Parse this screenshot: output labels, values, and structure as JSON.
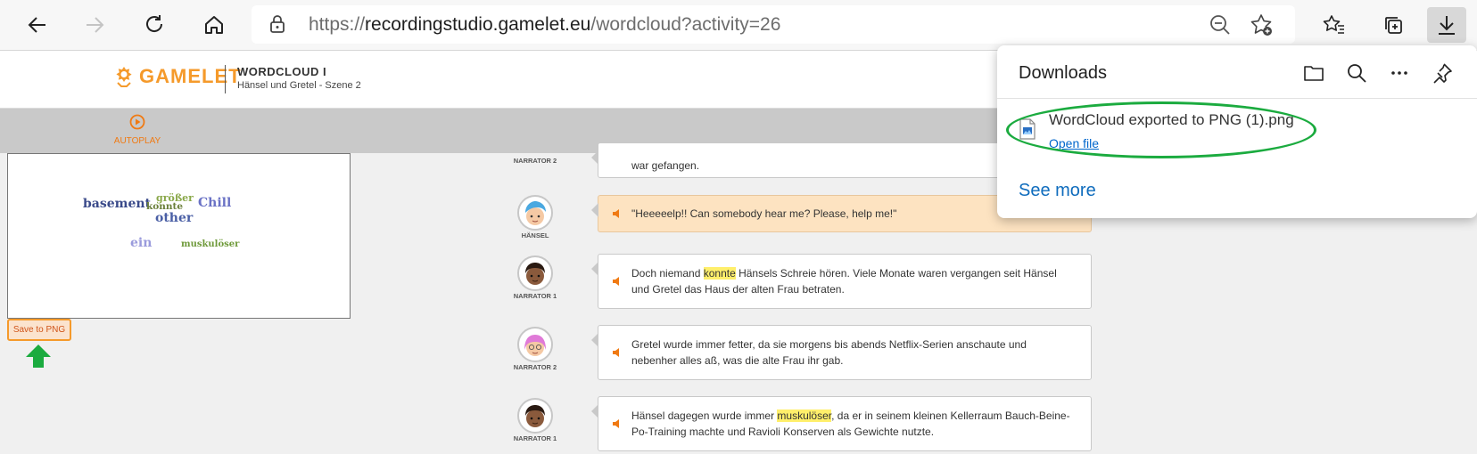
{
  "browser": {
    "url_scheme": "https://",
    "url_host": "recordingstudio.gamelet.eu",
    "url_path": "/wordcloud?activity=26"
  },
  "header": {
    "logo_text": "GAMELET",
    "title": "WORDCLOUD I",
    "subtitle": "Hänsel und Gretel - Szene 2"
  },
  "toolbar": {
    "autoplay_label": "AUTOPLAY"
  },
  "wordcloud": {
    "words": [
      {
        "text": "basement",
        "color": "#3a4a8a"
      },
      {
        "text": "größer",
        "color": "#8aa84a"
      },
      {
        "text": "konnte",
        "color": "#6a7f3a"
      },
      {
        "text": "other",
        "color": "#4a5fa5"
      },
      {
        "text": "Chill",
        "color": "#6a72c5"
      },
      {
        "text": "ein",
        "color": "#9a9bdc"
      },
      {
        "text": "muskulöser",
        "color": "#6f9a3b"
      }
    ],
    "save_label": "Save to PNG"
  },
  "dialogue": [
    {
      "speaker": "NARRATOR 2",
      "text": "war gefangen."
    },
    {
      "speaker": "HÄNSEL",
      "text": "\"Heeeeelp!! Can somebody hear me? Please, help me!\""
    },
    {
      "speaker": "NARRATOR 1",
      "before": "Doch niemand ",
      "highlight": "konnte",
      "after": " Hänsels Schreie hören. Viele Monate waren vergangen seit Hänsel und Gretel das Haus der alten Frau betraten."
    },
    {
      "speaker": "NARRATOR 2",
      "text": "Gretel wurde immer fetter, da sie morgens bis abends Netflix-Serien anschaute und nebenher alles aß, was die alte Frau ihr gab."
    },
    {
      "speaker": "NARRATOR 1",
      "before": "Hänsel dagegen wurde immer ",
      "highlight": "muskulöser",
      "after": ", da er in seinem kleinen Kellerraum Bauch-Beine-Po-Training machte und Ravioli Konserven als Gewichte nutzte."
    }
  ],
  "downloads": {
    "title": "Downloads",
    "file_name": "WordCloud exported to PNG (1).png",
    "open_file": "Open file",
    "see_more": "See more"
  },
  "colors": {
    "accent_orange": "#f59a2b",
    "link_blue": "#0f6cbd",
    "annotation_green": "#1bab3f",
    "highlight_yellow": "#ffef6b"
  }
}
